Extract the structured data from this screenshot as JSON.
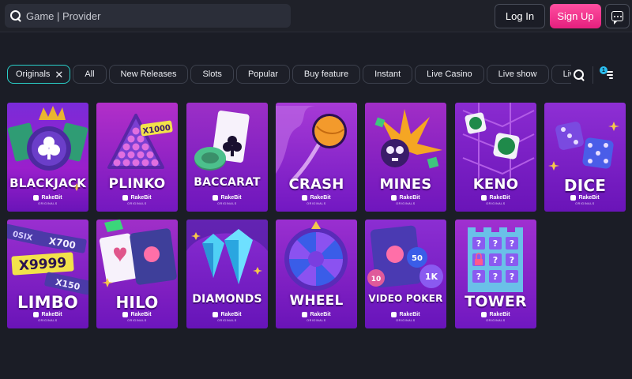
{
  "header": {
    "search_placeholder": "Game | Provider",
    "login_label": "Log In",
    "signup_label": "Sign Up",
    "chat_icon": "chat-icon",
    "search_icon": "search-icon"
  },
  "filters": {
    "active": "Originals",
    "items": [
      "All",
      "New Releases",
      "Slots",
      "Popular",
      "Buy feature",
      "Instant",
      "Live Casino",
      "Live show",
      "Live bac"
    ],
    "sort_badge": "1"
  },
  "brand": {
    "name": "RakeBit",
    "subtitle": "ORIGINALS"
  },
  "colors": {
    "accent": "#2ad0c9",
    "signup": "#e51f7e",
    "tile": "#8a1fd6"
  },
  "games": [
    {
      "name": "BLACKJACK"
    },
    {
      "name": "PLINKO"
    },
    {
      "name": "BACCARAT"
    },
    {
      "name": "CRASH"
    },
    {
      "name": "MINES"
    },
    {
      "name": "KENO"
    },
    {
      "name": "DICE"
    },
    {
      "name": "LIMBO"
    },
    {
      "name": "HILO"
    },
    {
      "name": "DIAMONDS"
    },
    {
      "name": "WHEEL"
    },
    {
      "name": "VIDEO POKER"
    },
    {
      "name": "TOWER"
    }
  ],
  "art": {
    "plinko_multiplier": "X1000",
    "limbo_multiplier": "X9999",
    "limbo_multiplier_2": "X700",
    "limbo_multiplier_3": "X150",
    "limbo_multiplier_4": "0SIX",
    "video_poker_chip_1": "50",
    "video_poker_chip_2": "1K",
    "video_poker_chip_3": "10",
    "tower_symbol": "?"
  }
}
